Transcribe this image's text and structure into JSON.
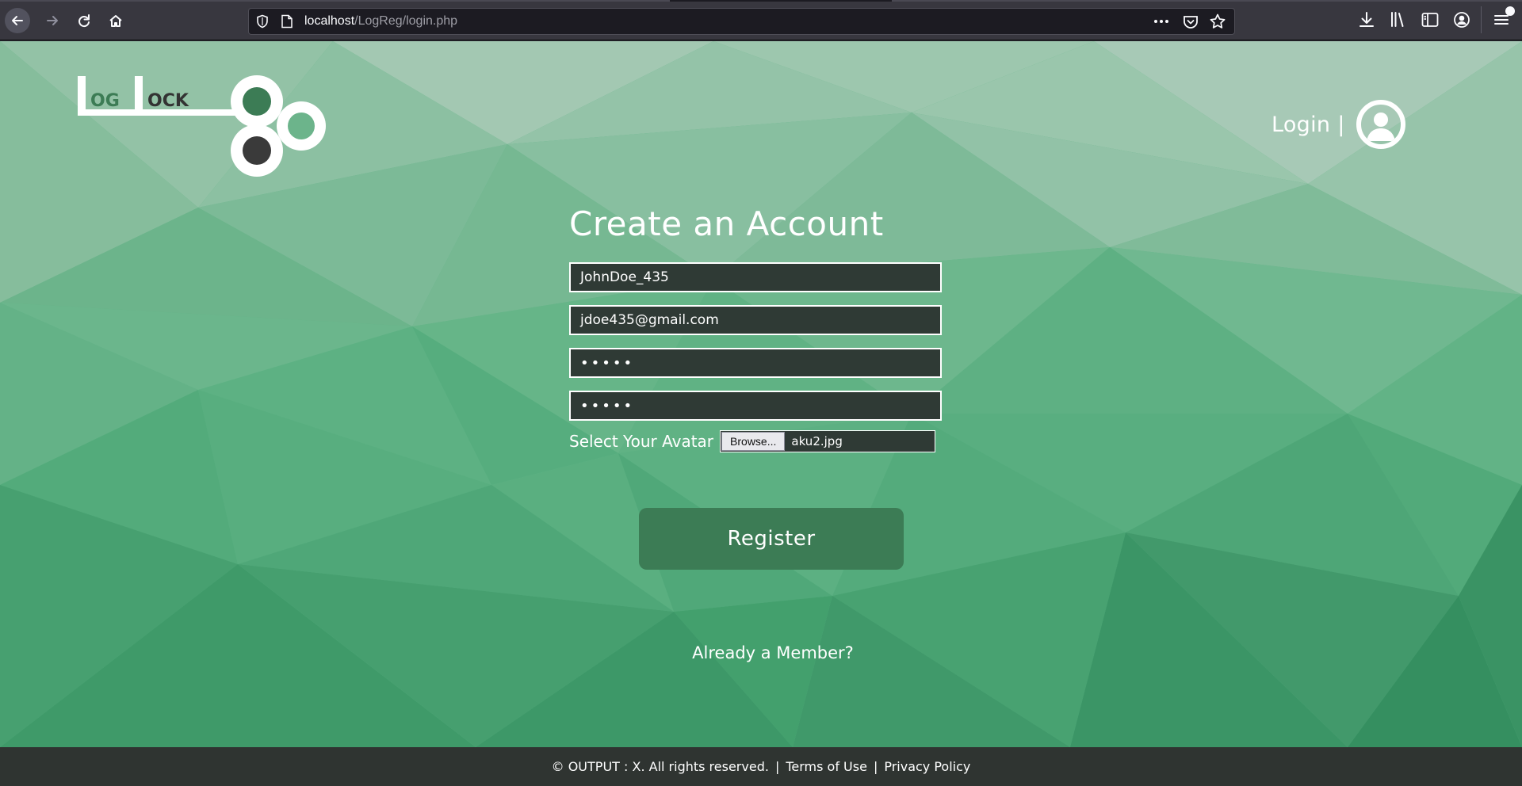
{
  "browser": {
    "url_host": "localhost",
    "url_path": "/LogReg/login.php"
  },
  "brand": {
    "logo_text_1": "OG",
    "logo_text_2": "OCK",
    "colors": {
      "logo_green": "#3c7c55",
      "logo_dark": "#333333"
    }
  },
  "header": {
    "login_label": "Login |"
  },
  "form": {
    "title": "Create an Account",
    "username_value": "JohnDoe_435",
    "email_value": "jdoe435@gmail.com",
    "password_value": "•••••",
    "confirm_password_value": "•••••",
    "avatar_label": "Select Your Avatar",
    "browse_label": "Browse...",
    "avatar_file": "aku2.jpg",
    "register_label": "Register",
    "member_link": "Already a Member?"
  },
  "footer": {
    "copyright": "© OUTPUT : X. All rights reserved.",
    "sep1": "|",
    "terms": "Terms of Use",
    "sep2": "|",
    "privacy": "Privacy Policy"
  },
  "colors": {
    "page_green": "#5fb588",
    "button_green": "#3c7c55",
    "field_bg": "#2f3a35",
    "footer_bg": "#2f3431"
  },
  "icons": [
    "back-arrow-icon",
    "forward-arrow-icon",
    "reload-icon",
    "home-icon",
    "shield-icon",
    "page-icon",
    "more-icon",
    "pocket-icon",
    "star-icon",
    "download-icon",
    "library-icon",
    "sidebar-icon",
    "account-icon",
    "hamburger-menu-icon",
    "user-avatar-icon"
  ]
}
